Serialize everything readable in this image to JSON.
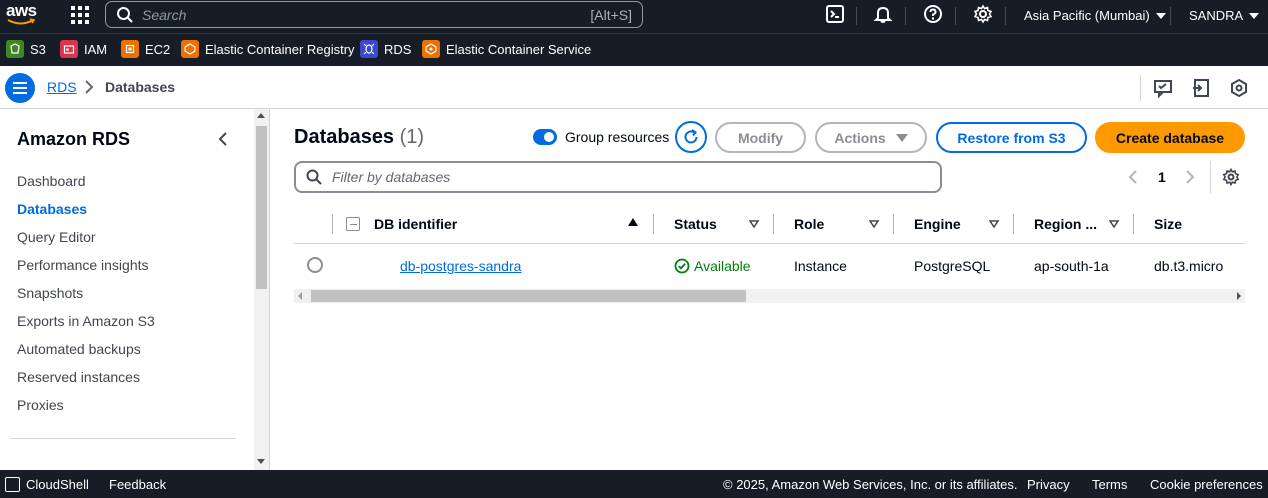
{
  "topnav": {
    "logo_text": "aws",
    "search_placeholder": "Search",
    "search_shortcut": "[Alt+S]",
    "region": "Asia Pacific (Mumbai)",
    "user": "SANDRA"
  },
  "favorites": [
    {
      "label": "S3",
      "color": "#3f8624"
    },
    {
      "label": "IAM",
      "color": "#dd344c"
    },
    {
      "label": "EC2",
      "color": "#ed7100"
    },
    {
      "label": "Elastic Container Registry",
      "color": "#ed7100"
    },
    {
      "label": "RDS",
      "color": "#3b48cc"
    },
    {
      "label": "Elastic Container Service",
      "color": "#ed7100"
    }
  ],
  "breadcrumb": {
    "parent": "RDS",
    "current": "Databases"
  },
  "sidebar": {
    "title": "Amazon RDS",
    "items": [
      {
        "label": "Dashboard",
        "active": false
      },
      {
        "label": "Databases",
        "active": true
      },
      {
        "label": "Query Editor",
        "active": false
      },
      {
        "label": "Performance insights",
        "active": false
      },
      {
        "label": "Snapshots",
        "active": false
      },
      {
        "label": "Exports in Amazon S3",
        "active": false
      },
      {
        "label": "Automated backups",
        "active": false
      },
      {
        "label": "Reserved instances",
        "active": false
      },
      {
        "label": "Proxies",
        "active": false
      }
    ]
  },
  "main": {
    "heading": "Databases",
    "count": "(1)",
    "group_resources_label": "Group resources",
    "group_resources_on": true,
    "modify_label": "Modify",
    "actions_label": "Actions",
    "restore_label": "Restore from S3",
    "create_label": "Create database",
    "filter_placeholder": "Filter by databases",
    "page_number": "1"
  },
  "table": {
    "columns": [
      "DB identifier",
      "Status",
      "Role",
      "Engine",
      "Region ...",
      "Size"
    ],
    "rows": [
      {
        "db_identifier": "db-postgres-sandra",
        "status": "Available",
        "role": "Instance",
        "engine": "PostgreSQL",
        "region": "ap-south-1a",
        "size": "db.t3.micro"
      }
    ]
  },
  "footer": {
    "cloudshell": "CloudShell",
    "feedback": "Feedback",
    "copyright": "© 2025, Amazon Web Services, Inc. or its affiliates.",
    "privacy": "Privacy",
    "terms": "Terms",
    "cookie": "Cookie preferences"
  },
  "colors": {
    "nav_bg": "#161d26",
    "link": "#006ce0",
    "primary": "#ff9900",
    "success": "#037f0c"
  }
}
